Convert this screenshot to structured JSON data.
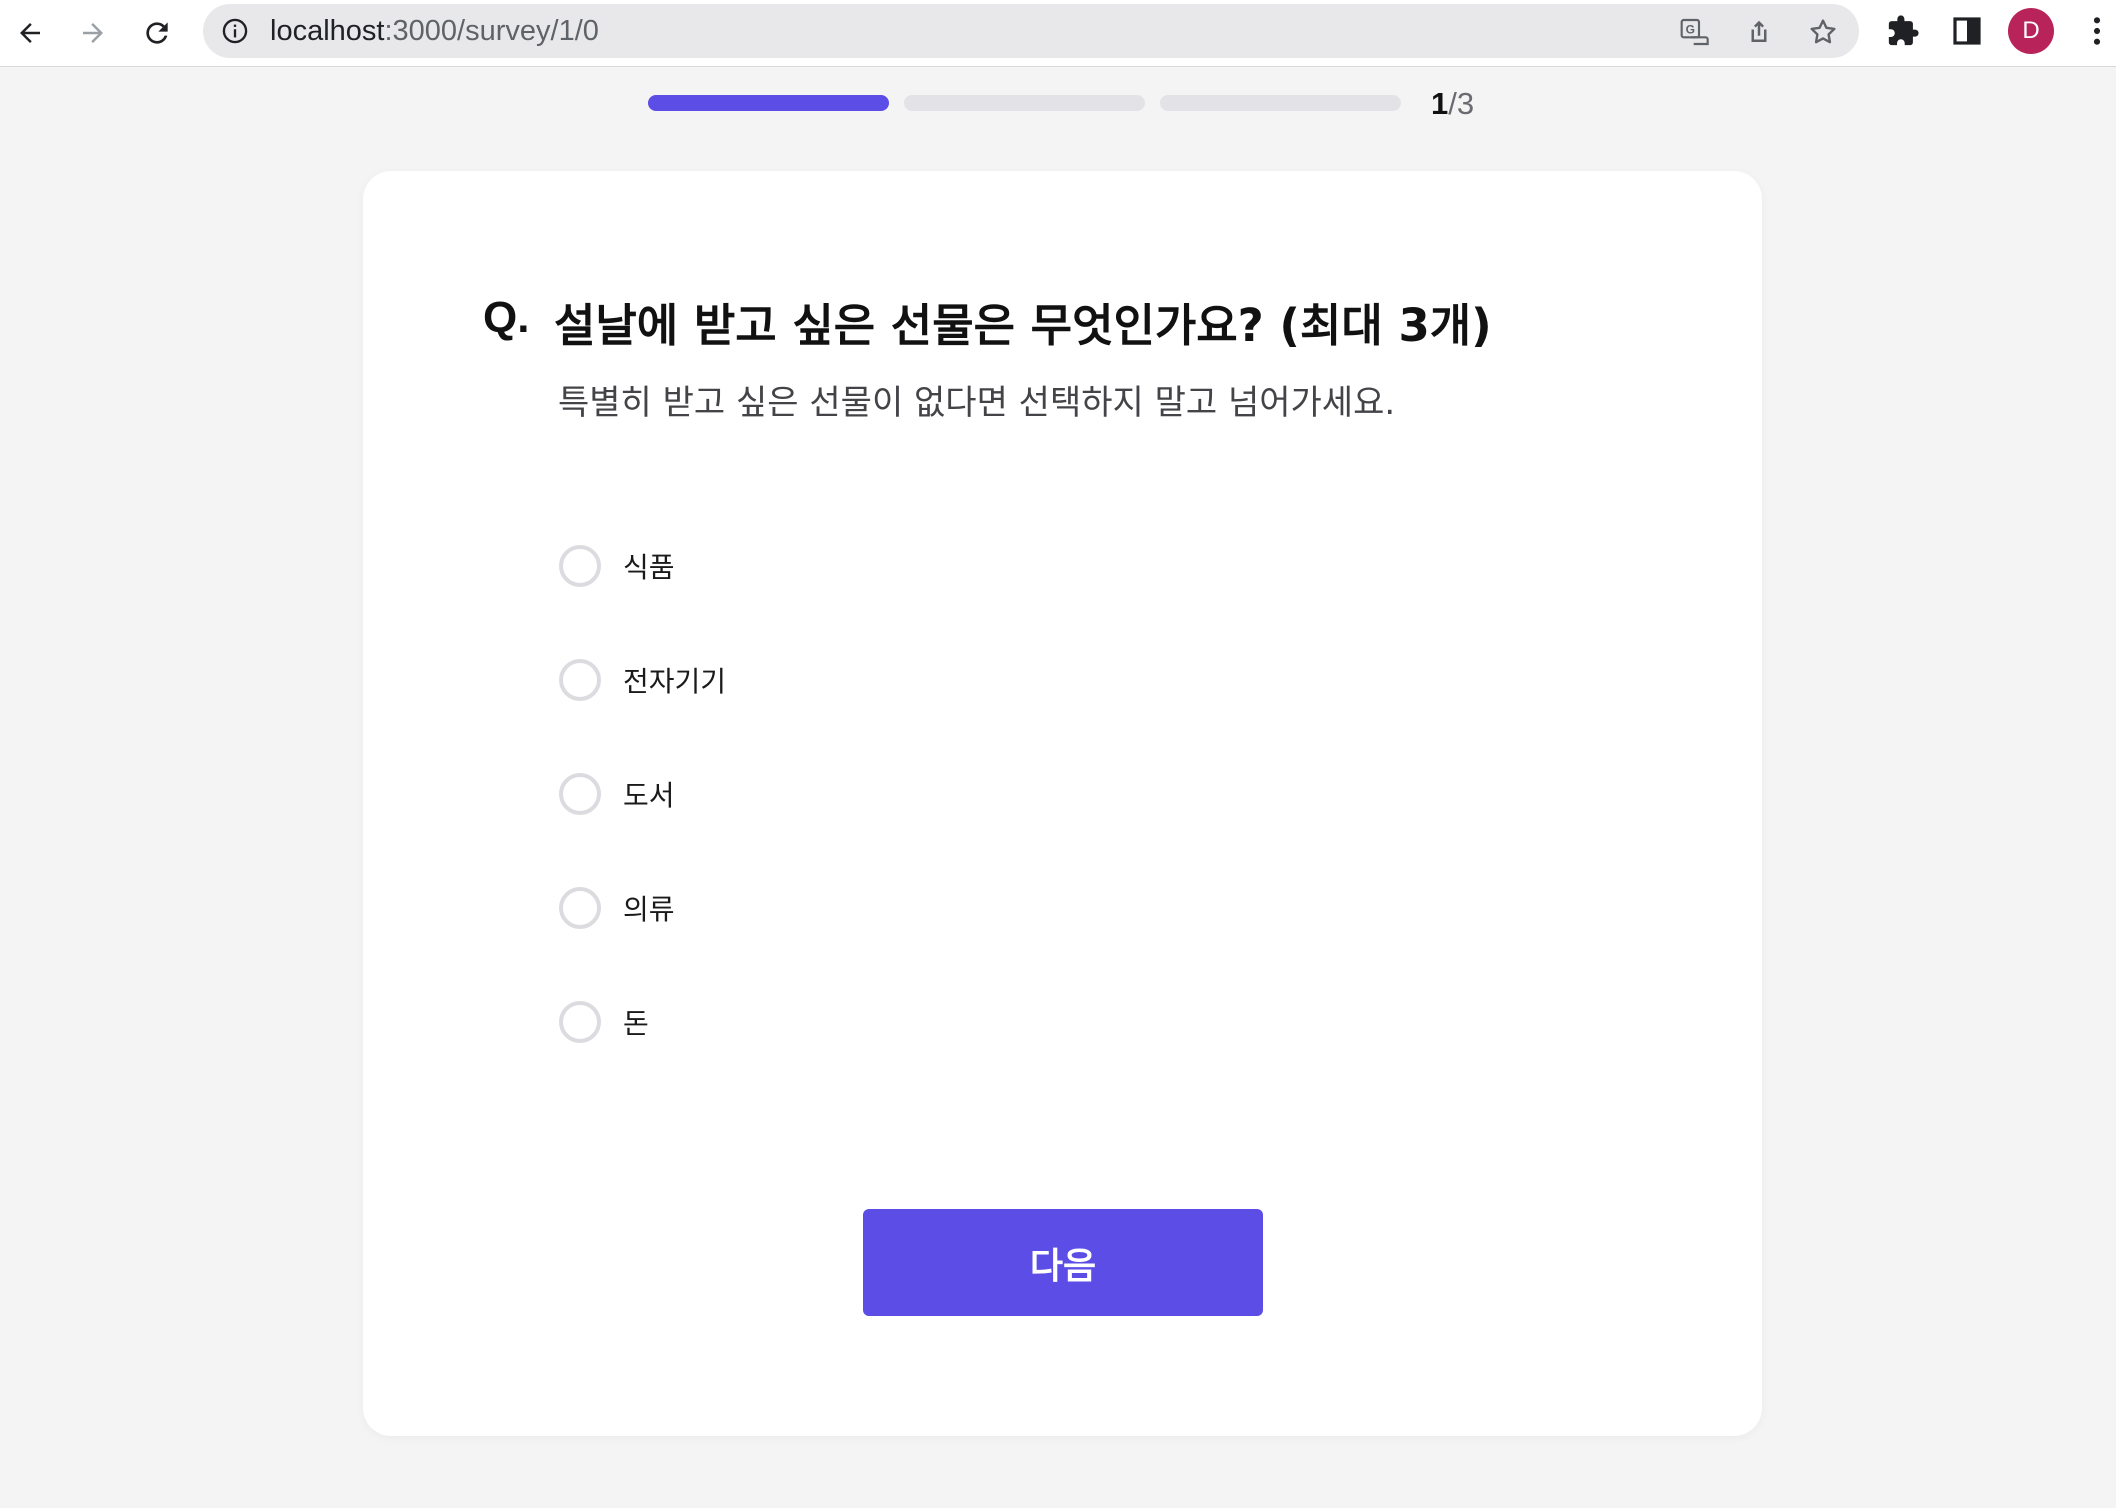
{
  "browser": {
    "url_host": "localhost",
    "url_path": ":3000/survey/1/0",
    "profile_initial": "D",
    "profile_color": "#b8245a"
  },
  "progress": {
    "current": "1",
    "total": "/3",
    "filled_segments": 1,
    "total_segments": 3,
    "accent": "#5b4de6"
  },
  "question": {
    "prefix": "Q.",
    "title": "설날에 받고 싶은 선물은 무엇인가요? (최대 3개)",
    "subtitle": "특별히 받고 싶은 선물이 없다면 선택하지 말고 넘어가세요."
  },
  "options": [
    {
      "label": "식품"
    },
    {
      "label": "전자기기"
    },
    {
      "label": "도서"
    },
    {
      "label": "의류"
    },
    {
      "label": "돈"
    }
  ],
  "next_button": {
    "label": "다음",
    "color": "#5b4de6"
  }
}
